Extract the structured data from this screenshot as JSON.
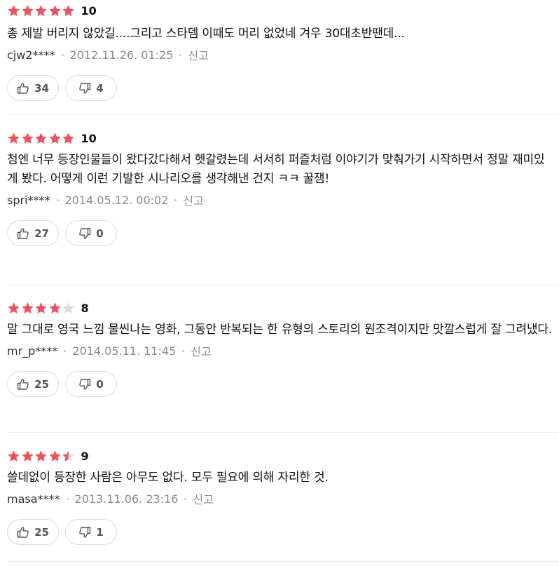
{
  "colors": {
    "star_filled": "#f0505a",
    "star_empty": "#dcdcdc",
    "meta_text": "#8c8c8c"
  },
  "reviews": [
    {
      "stars": 5,
      "score": "10",
      "comment": "총 제발 버리지 않았길....그리고 스타뎀 이때도 머리 없었네 겨우 30대초반땐데...",
      "user": "cjw2****",
      "date": "2012.11.26. 01:25",
      "report": "신고",
      "likes": "34",
      "dislikes": "4"
    },
    {
      "stars": 5,
      "score": "10",
      "comment": "첨엔 너무 등장인물들이 왔다갔다해서 헷갈렸는데 서서히 퍼즐처럼 이야기가 맞춰가기 시작하면서 정말 재미있게 봤다. 어떻게 이런 기발한 시나리오를 생각해낸 건지 ㅋㅋ 꿀잼!",
      "user": "spri****",
      "date": "2014.05.12. 00:02",
      "report": "신고",
      "likes": "27",
      "dislikes": "0"
    },
    {
      "stars": 4,
      "score": "8",
      "comment": "말 그대로 영국 느낌 물씬나는 영화, 그동안 반복되는 한 유형의 스토리의 원조격이지만 맛깔스럽게 잘 그려냈다.",
      "user": "mr_p****",
      "date": "2014.05.11. 11:45",
      "report": "신고",
      "likes": "25",
      "dislikes": "0"
    },
    {
      "stars": 4.5,
      "score": "9",
      "comment": "쓸데없이 등장한 사람은 아무도 없다. 모두 필요에 의해 자리한 것.",
      "user": "masa****",
      "date": "2013.11.06. 23:16",
      "report": "신고",
      "likes": "25",
      "dislikes": "1"
    }
  ]
}
